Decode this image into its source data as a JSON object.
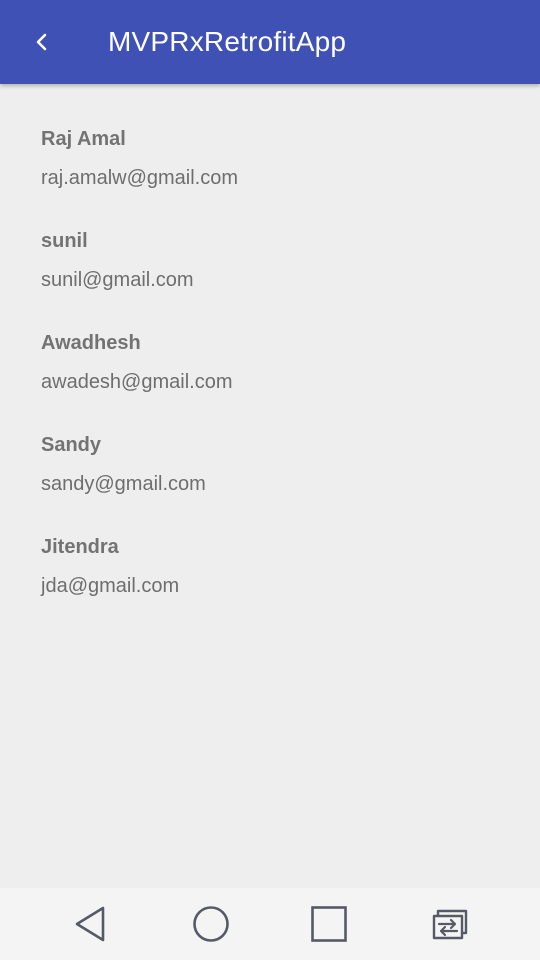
{
  "app_bar": {
    "title": "MVPRxRetrofitApp",
    "back_icon": "chevron-left-icon",
    "color": "#3f51b5"
  },
  "users": [
    {
      "name": "Raj Amal",
      "email": "raj.amalw@gmail.com"
    },
    {
      "name": "sunil",
      "email": "sunil@gmail.com"
    },
    {
      "name": "Awadhesh",
      "email": "awadesh@gmail.com"
    },
    {
      "name": "Sandy",
      "email": "sandy@gmail.com"
    },
    {
      "name": "Jitendra",
      "email": "jda@gmail.com"
    }
  ],
  "nav_bar": {
    "buttons": [
      {
        "icon": "back-triangle-icon"
      },
      {
        "icon": "home-circle-icon"
      },
      {
        "icon": "recents-square-icon"
      },
      {
        "icon": "switch-apps-icon"
      }
    ]
  }
}
